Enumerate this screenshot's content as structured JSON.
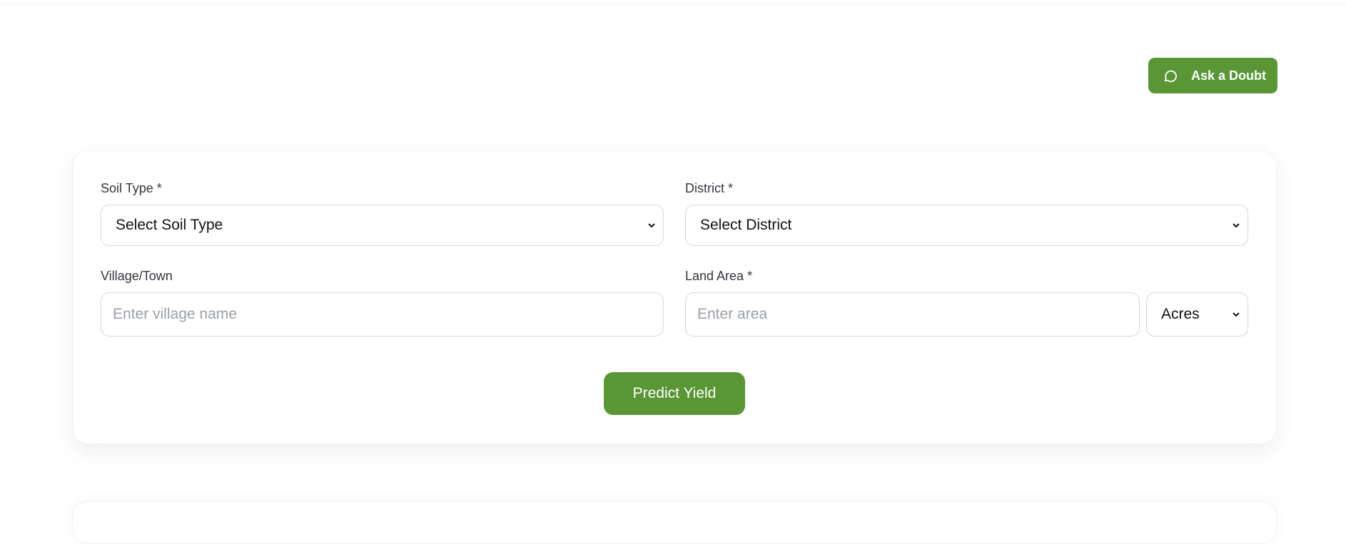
{
  "header": {
    "ask_button_label": "Ask a Doubt",
    "ask_icon": "chat-bubble-icon"
  },
  "form": {
    "soil_type": {
      "label": "Soil Type *",
      "selected": "Select Soil Type"
    },
    "district": {
      "label": "District *",
      "selected": "Select District"
    },
    "village": {
      "label": "Village/Town",
      "placeholder": "Enter village name",
      "value": ""
    },
    "land_area": {
      "label": "Land Area *",
      "placeholder": "Enter area",
      "value": "",
      "unit_selected": "Acres"
    },
    "submit_label": "Predict Yield"
  },
  "colors": {
    "accent": "#5a9536",
    "label_text": "#33363b",
    "placeholder": "#9aa0a7",
    "border": "#d5d8dc"
  }
}
